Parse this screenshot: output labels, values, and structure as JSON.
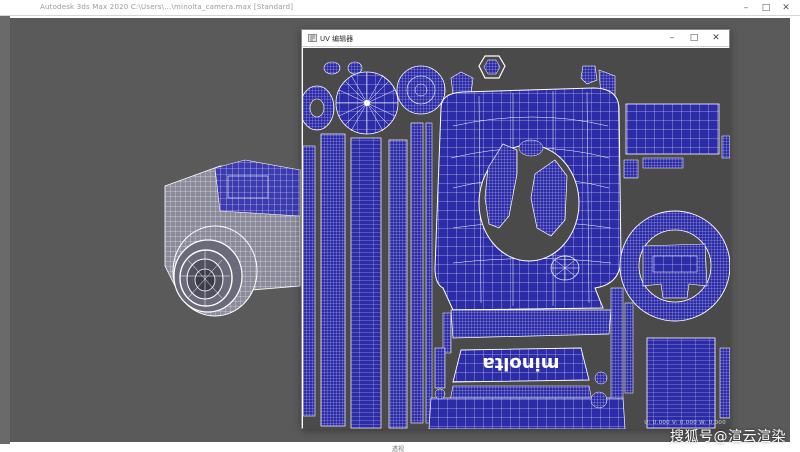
{
  "app": {
    "title": "Autodesk 3ds Max 2020   C:\\Users\\...\\minolta_camera.max   [Standard]",
    "window_controls": {
      "minimize": "–",
      "maximize": "□",
      "close": "✕"
    }
  },
  "uv_editor": {
    "title": "UV 编辑器",
    "window_controls": {
      "minimize": "–",
      "maximize": "□",
      "close": "✕"
    },
    "status": "U: 0.000   V: 0.000   W: 0.000",
    "brand_text": "minolta",
    "colors": {
      "shell_fill": "#2a2aa6",
      "wire": "#ffffff",
      "background": "#4a4a4a"
    }
  },
  "viewport": {
    "label": "透视",
    "background": "#5a5a5a"
  },
  "watermark": "搜狐号@渲云渲染"
}
